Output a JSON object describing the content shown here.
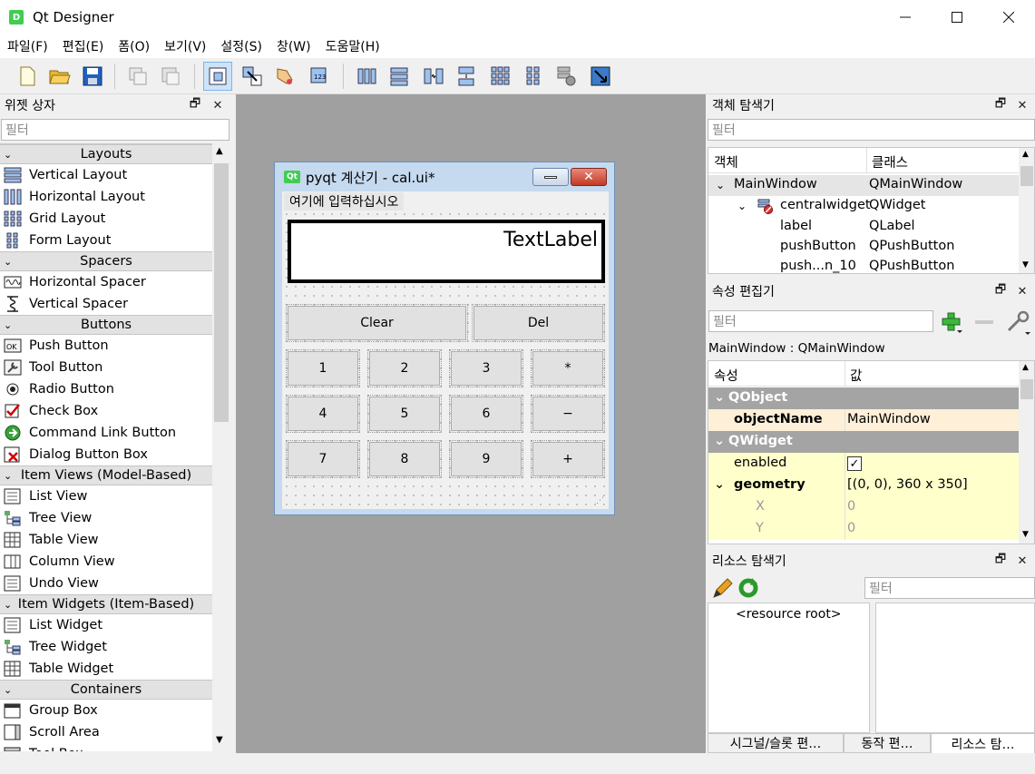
{
  "window": {
    "title": "Qt Designer",
    "app_badge": "D"
  },
  "menu": [
    "파일(F)",
    "편집(E)",
    "폼(O)",
    "보기(V)",
    "설정(S)",
    "창(W)",
    "도움말(H)"
  ],
  "widget_box": {
    "title": "위젯 상자",
    "filter_placeholder": "필터",
    "rows": [
      {
        "kind": "cat",
        "label": "Layouts"
      },
      {
        "kind": "item",
        "label": "Vertical Layout",
        "icon": "vertical-layout-icon"
      },
      {
        "kind": "item",
        "label": "Horizontal Layout",
        "icon": "horizontal-layout-icon"
      },
      {
        "kind": "item",
        "label": "Grid Layout",
        "icon": "grid-layout-icon"
      },
      {
        "kind": "item",
        "label": "Form Layout",
        "icon": "form-layout-icon"
      },
      {
        "kind": "cat",
        "label": "Spacers"
      },
      {
        "kind": "item",
        "label": "Horizontal Spacer",
        "icon": "horizontal-spacer-icon"
      },
      {
        "kind": "item",
        "label": "Vertical Spacer",
        "icon": "vertical-spacer-icon"
      },
      {
        "kind": "cat",
        "label": "Buttons"
      },
      {
        "kind": "item",
        "label": "Push Button",
        "icon": "push-button-icon"
      },
      {
        "kind": "item",
        "label": "Tool Button",
        "icon": "tool-button-icon"
      },
      {
        "kind": "item",
        "label": "Radio Button",
        "icon": "radio-button-icon"
      },
      {
        "kind": "item",
        "label": "Check Box",
        "icon": "check-box-icon"
      },
      {
        "kind": "item",
        "label": "Command Link Button",
        "icon": "command-link-icon"
      },
      {
        "kind": "item",
        "label": "Dialog Button Box",
        "icon": "dialog-button-box-icon"
      },
      {
        "kind": "cat",
        "label": "Item Views (Model-Based)"
      },
      {
        "kind": "item",
        "label": "List View",
        "icon": "list-view-icon"
      },
      {
        "kind": "item",
        "label": "Tree View",
        "icon": "tree-view-icon"
      },
      {
        "kind": "item",
        "label": "Table View",
        "icon": "table-view-icon"
      },
      {
        "kind": "item",
        "label": "Column View",
        "icon": "column-view-icon"
      },
      {
        "kind": "item",
        "label": "Undo View",
        "icon": "undo-view-icon"
      },
      {
        "kind": "cat",
        "label": "Item Widgets (Item-Based)"
      },
      {
        "kind": "item",
        "label": "List Widget",
        "icon": "list-widget-icon"
      },
      {
        "kind": "item",
        "label": "Tree Widget",
        "icon": "tree-widget-icon"
      },
      {
        "kind": "item",
        "label": "Table Widget",
        "icon": "table-widget-icon"
      },
      {
        "kind": "cat",
        "label": "Containers"
      },
      {
        "kind": "item",
        "label": "Group Box",
        "icon": "group-box-icon"
      },
      {
        "kind": "item",
        "label": "Scroll Area",
        "icon": "scroll-area-icon"
      },
      {
        "kind": "item",
        "label": "Tool Box",
        "icon": "tool-box-icon"
      }
    ]
  },
  "form": {
    "title": "pyqt 계산기 - cal.ui*",
    "badge": "Qt",
    "menu_placeholder": "여기에 입력하십시오",
    "label_text": "TextLabel",
    "buttons": {
      "clear": "Clear",
      "del": "Del",
      "b1": "1",
      "b2": "2",
      "b3": "3",
      "mul": "*",
      "b4": "4",
      "b5": "5",
      "b6": "6",
      "minus": "−",
      "b7": "7",
      "b8": "8",
      "b9": "9",
      "plus": "+"
    }
  },
  "object_inspector": {
    "title": "객체 탐색기",
    "filter_placeholder": "필터",
    "col_object": "객체",
    "col_class": "클래스",
    "rows": [
      {
        "name": "MainWindow",
        "cls": "QMainWindow"
      },
      {
        "name": "centralwidget",
        "cls": "QWidget"
      },
      {
        "name": "label",
        "cls": "QLabel"
      },
      {
        "name": "pushButton",
        "cls": "QPushButton"
      },
      {
        "name": "push...n_10",
        "cls": "QPushButton"
      }
    ]
  },
  "property_editor": {
    "title": "속성 편집기",
    "filter_placeholder": "필터",
    "subtitle": "MainWindow : QMainWindow",
    "col_property": "속성",
    "col_value": "값",
    "rows": {
      "qobject": "QObject",
      "objectname_k": "objectName",
      "objectname_v": "MainWindow",
      "qwidget": "QWidget",
      "enabled_k": "enabled",
      "geometry_k": "geometry",
      "geometry_v": "[(0, 0), 360 x 350]",
      "x_k": "X",
      "x_v": "0",
      "y_k": "Y",
      "y_v": "0"
    }
  },
  "resource_browser": {
    "title": "리소스 탐색기",
    "filter_placeholder": "필터",
    "root": "<resource root>"
  },
  "bottom_tabs": [
    "시그널/슬롯 편…",
    "동작 편…",
    "리소스 탐…"
  ]
}
